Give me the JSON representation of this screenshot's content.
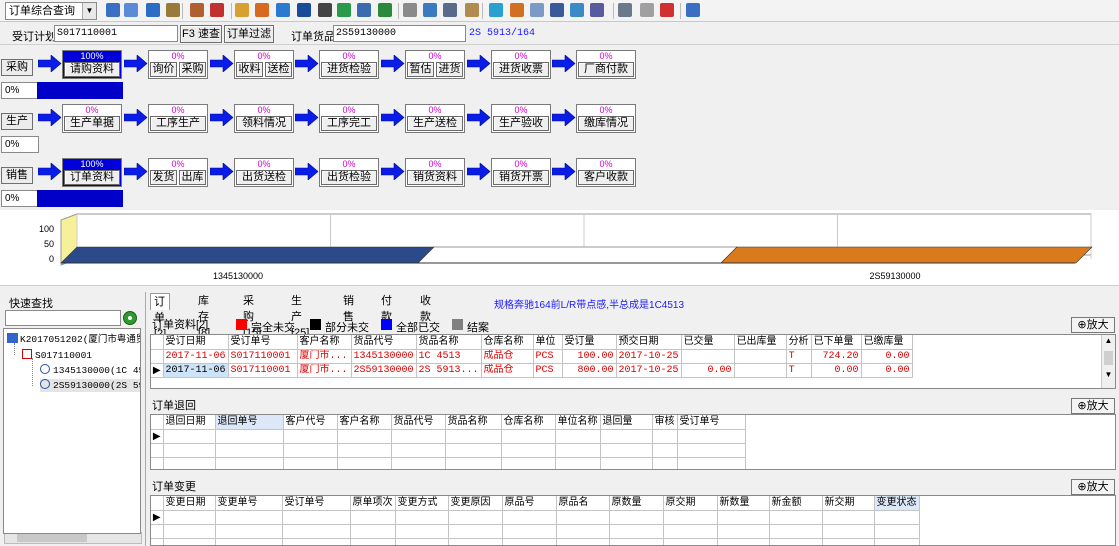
{
  "toolbar": {
    "query_select": "订单综合查询"
  },
  "search_row": {
    "plan_label": "受订计划",
    "plan_value": "S017110001",
    "quick_check_btn": "F3 速查",
    "order_filter_btn": "订单过滤",
    "goods_label": "订单货品",
    "goods_value": "2S59130000",
    "goods_desc": "2S 5913/164"
  },
  "flows": [
    {
      "name": "采购",
      "progress": "0%",
      "progress_fill": 1.0,
      "steps": [
        {
          "pct": "100%",
          "done": true,
          "buttons": [
            "请购资料"
          ]
        },
        {
          "pct": "0%",
          "done": false,
          "buttons": [
            "询价",
            "采购"
          ]
        },
        {
          "pct": "0%",
          "done": false,
          "buttons": [
            "收料",
            "送检"
          ]
        },
        {
          "pct": "0%",
          "done": false,
          "buttons": [
            "进货检验"
          ]
        },
        {
          "pct": "0%",
          "done": false,
          "buttons": [
            "暂估",
            "进货"
          ]
        },
        {
          "pct": "0%",
          "done": false,
          "buttons": [
            "进货收票"
          ]
        },
        {
          "pct": "0%",
          "done": false,
          "buttons": [
            "厂商付款"
          ]
        }
      ]
    },
    {
      "name": "生产",
      "progress": "0%",
      "progress_fill": 0,
      "steps": [
        {
          "pct": "0%",
          "done": false,
          "buttons": [
            "生产单据"
          ]
        },
        {
          "pct": "0%",
          "done": false,
          "buttons": [
            "工序生产"
          ]
        },
        {
          "pct": "0%",
          "done": false,
          "buttons": [
            "领料情况"
          ]
        },
        {
          "pct": "0%",
          "done": false,
          "buttons": [
            "工序完工"
          ]
        },
        {
          "pct": "0%",
          "done": false,
          "buttons": [
            "生产送检"
          ]
        },
        {
          "pct": "0%",
          "done": false,
          "buttons": [
            "生产验收"
          ]
        },
        {
          "pct": "0%",
          "done": false,
          "buttons": [
            "缴库情况"
          ]
        }
      ]
    },
    {
      "name": "销售",
      "progress": "0%",
      "progress_fill": 1.0,
      "steps": [
        {
          "pct": "100%",
          "done": true,
          "buttons": [
            "订单资料"
          ]
        },
        {
          "pct": "0%",
          "done": false,
          "buttons": [
            "发货",
            "出库"
          ]
        },
        {
          "pct": "0%",
          "done": false,
          "buttons": [
            "出货送检"
          ]
        },
        {
          "pct": "0%",
          "done": false,
          "buttons": [
            "出货检验"
          ]
        },
        {
          "pct": "0%",
          "done": false,
          "buttons": [
            "销货资料"
          ]
        },
        {
          "pct": "0%",
          "done": false,
          "buttons": [
            "销货开票"
          ]
        },
        {
          "pct": "0%",
          "done": false,
          "buttons": [
            "客户收款"
          ]
        }
      ]
    }
  ],
  "chart_data": {
    "type": "bar",
    "orientation": "horizontal-3d",
    "y_ticks": [
      "100",
      "50",
      "0"
    ],
    "ylim": [
      0,
      100
    ],
    "categories": [
      "1345130000",
      "2S59130000"
    ],
    "segments": [
      {
        "color": "#2a4a8a"
      },
      {
        "color": "#ffffff"
      },
      {
        "color": "#d97a1c"
      }
    ],
    "grid": true
  },
  "quick_find": {
    "title": "快速查找",
    "search_value": ""
  },
  "tree": {
    "root": "K2017051202(厦门市粤通贸",
    "order": "S017110001",
    "items": [
      "1345130000(1C 4513",
      "2S59130000(2S 5913"
    ]
  },
  "tabs": [
    "订单[2]",
    "库存[8]",
    "采购[15]",
    "生产[25]",
    "销售",
    "付款",
    "收款"
  ],
  "spec_text": "规格奔驰164前L/R带点感,半总成是1C4513",
  "order_section": {
    "title": "订单资料[2]",
    "legend": [
      {
        "label": "完全未交",
        "color": "#ff0000"
      },
      {
        "label": "部分未交",
        "color": "#000000"
      },
      {
        "label": "全部已交",
        "color": "#0000ff"
      },
      {
        "label": "结案",
        "color": "#808080"
      }
    ],
    "zoom_label": "放大",
    "columns": [
      "受订日期",
      "受订单号",
      "客户名称",
      "货品代号",
      "货品名称",
      "仓库名称",
      "单位",
      "受订量",
      "预交日期",
      "已交量",
      "已出库量",
      "分析",
      "已下单量",
      "已缴库量"
    ],
    "rows": [
      [
        "2017-11-06",
        "S017110001",
        "厦门市...",
        "1345130000",
        "1C 4513",
        "成品仓",
        "PCS",
        "100.00",
        "2017-10-25",
        "",
        "",
        "T",
        "724.20",
        "0.00"
      ],
      [
        "2017-11-06",
        "S017110001",
        "厦门市...",
        "2S59130000",
        "2S 5913...",
        "成品仓",
        "PCS",
        "800.00",
        "2017-10-25",
        "0.00",
        "",
        "T",
        "0.00",
        "0.00"
      ]
    ]
  },
  "return_section": {
    "title": "订单退回",
    "zoom_label": "放大",
    "columns": [
      "退回日期",
      "退回单号",
      "客户代号",
      "客户名称",
      "货品代号",
      "货品名称",
      "仓库名称",
      "单位名称",
      "退回量",
      "审核",
      "受订单号"
    ]
  },
  "change_section": {
    "title": "订单变更",
    "zoom_label": "放大",
    "columns": [
      "变更日期",
      "变更单号",
      "受订单号",
      "原单项次",
      "变更方式",
      "变更原因",
      "原品号",
      "原品名",
      "原数量",
      "原交期",
      "新数量",
      "新金额",
      "新交期",
      "变更状态"
    ]
  }
}
